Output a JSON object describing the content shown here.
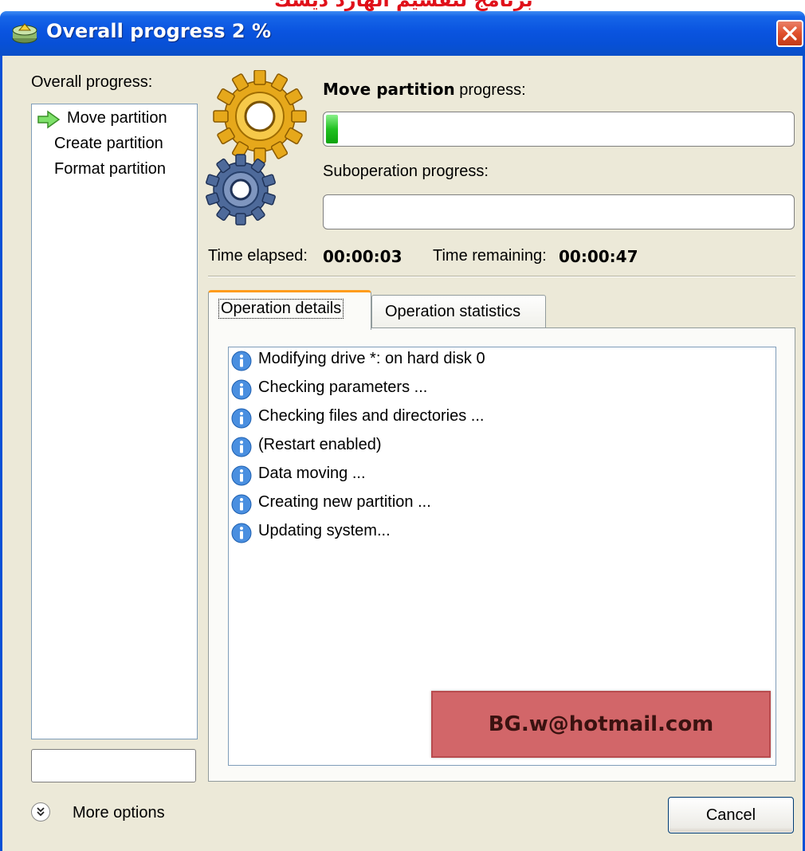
{
  "banner": {
    "text": "برنامج لتقسيم الهارد ديسك"
  },
  "window": {
    "title": "Overall progress 2 %"
  },
  "left_panel": {
    "heading": "Overall progress:",
    "operations": [
      {
        "label": "Move partition",
        "current": true
      },
      {
        "label": "Create partition",
        "current": false
      },
      {
        "label": "Format partition",
        "current": false
      }
    ],
    "more_options_label": "More options"
  },
  "progress": {
    "operation_name": "Move partition",
    "operation_suffix": " progress:",
    "operation_fraction": 0.02,
    "suboperation_label": "Suboperation progress:",
    "suboperation_fraction": 0,
    "time_elapsed_label": "Time elapsed:",
    "time_elapsed": "00:00:03",
    "time_remaining_label": "Time remaining:",
    "time_remaining": "00:00:47"
  },
  "tabs": [
    {
      "label": "Operation details",
      "active": true
    },
    {
      "label": "Operation statistics",
      "active": false
    }
  ],
  "log": [
    {
      "icon": "info-icon",
      "text": "Modifying drive *: on hard disk 0"
    },
    {
      "icon": "info-icon",
      "text": "Checking parameters ..."
    },
    {
      "icon": "info-icon",
      "text": "Checking files and directories ..."
    },
    {
      "icon": "info-icon",
      "text": "(Restart enabled)"
    },
    {
      "icon": "info-icon",
      "text": "Data moving ..."
    },
    {
      "icon": "info-icon",
      "text": "Creating new partition ..."
    },
    {
      "icon": "info-icon",
      "text": "Updating system..."
    }
  ],
  "watermark": {
    "text": "BG.w@hotmail.com"
  },
  "buttons": {
    "cancel": "Cancel"
  },
  "colors": {
    "title_bar": "#0750d6",
    "dialog_bg": "#ece9d8",
    "progress_green": "#22c122",
    "active_tab_accent": "#ff9c1c",
    "close_button": "#e0502c",
    "banner_text": "#e0101a",
    "watermark_bg": "#d26669"
  }
}
